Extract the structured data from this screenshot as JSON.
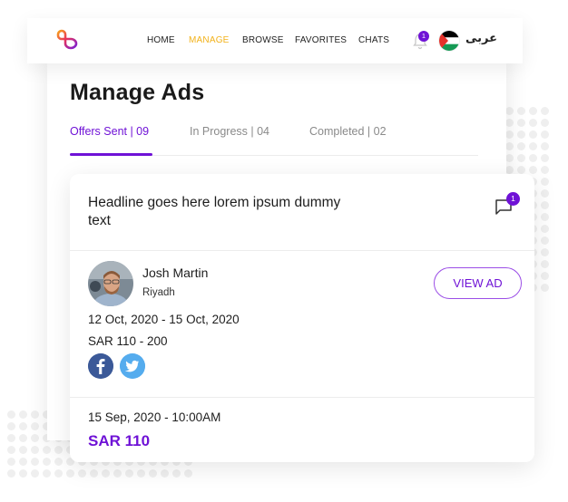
{
  "navbar": {
    "logo": "app-logo",
    "items": [
      {
        "label": "HOME",
        "active": false
      },
      {
        "label": "MANAGE",
        "active": true
      },
      {
        "label": "BROWSE",
        "active": false
      },
      {
        "label": "FAVORITES",
        "active": false
      },
      {
        "label": "CHATS",
        "active": false
      }
    ],
    "notifications_count": "1",
    "language_label": "عربى",
    "flag": "palestine-flag"
  },
  "page": {
    "title": "Manage Ads",
    "tabs": [
      {
        "label": "Offers Sent  | 09",
        "active": true
      },
      {
        "label": "In Progress | 04",
        "active": false
      },
      {
        "label": "Completed  | 02",
        "active": false
      }
    ]
  },
  "ad_card": {
    "headline": "Headline goes here lorem ipsum dummy text",
    "chat_badge_count": "1",
    "user": {
      "name": "Josh Martin",
      "city": "Riyadh"
    },
    "view_ad_label": "VIEW AD",
    "date_range": "12 Oct, 2020 - 15 Oct, 2020",
    "price_range": "SAR 110 - 200",
    "social": [
      "facebook",
      "twitter"
    ],
    "offer": {
      "datetime": "15 Sep, 2020 - 10:00AM",
      "price": "SAR 110"
    }
  },
  "colors": {
    "accent_purple": "#6f12d6",
    "nav_active": "#f2b21b",
    "facebook": "#3b5998",
    "twitter": "#55acee"
  }
}
